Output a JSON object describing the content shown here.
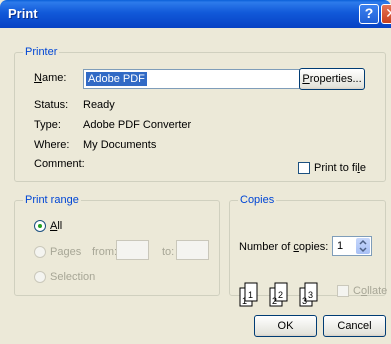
{
  "window": {
    "title": "Print"
  },
  "printer": {
    "group_label": "Printer",
    "name_label": "Name:",
    "name_value": "Adobe PDF",
    "properties_label": "Properties...",
    "status_label": "Status:",
    "status_value": "Ready",
    "type_label": "Type:",
    "type_value": "Adobe PDF Converter",
    "where_label": "Where:",
    "where_value": "My Documents",
    "comment_label": "Comment:",
    "print_to_file_label": "Print to file"
  },
  "print_range": {
    "group_label": "Print range",
    "all_label": "All",
    "pages_label": "Pages",
    "from_label": "from:",
    "to_label": "to:",
    "selection_label": "Selection",
    "selected": "All"
  },
  "copies": {
    "group_label": "Copies",
    "number_label": "Number of copies:",
    "number_value": "1",
    "collate_label": "Collate",
    "collate_pages": [
      "1",
      "1",
      "2",
      "2",
      "3",
      "3"
    ]
  },
  "buttons": {
    "ok": "OK",
    "cancel": "Cancel"
  },
  "icons": {
    "help": "help-icon",
    "close": "close-icon",
    "dropdown": "chevron-down-icon",
    "spinner": "up-down-arrows-icon"
  },
  "colors": {
    "titlebar": "#0A5FD8",
    "group_label": "#0046D5",
    "selection": "#316AC5",
    "dialog_bg": "#ECE9D8"
  }
}
